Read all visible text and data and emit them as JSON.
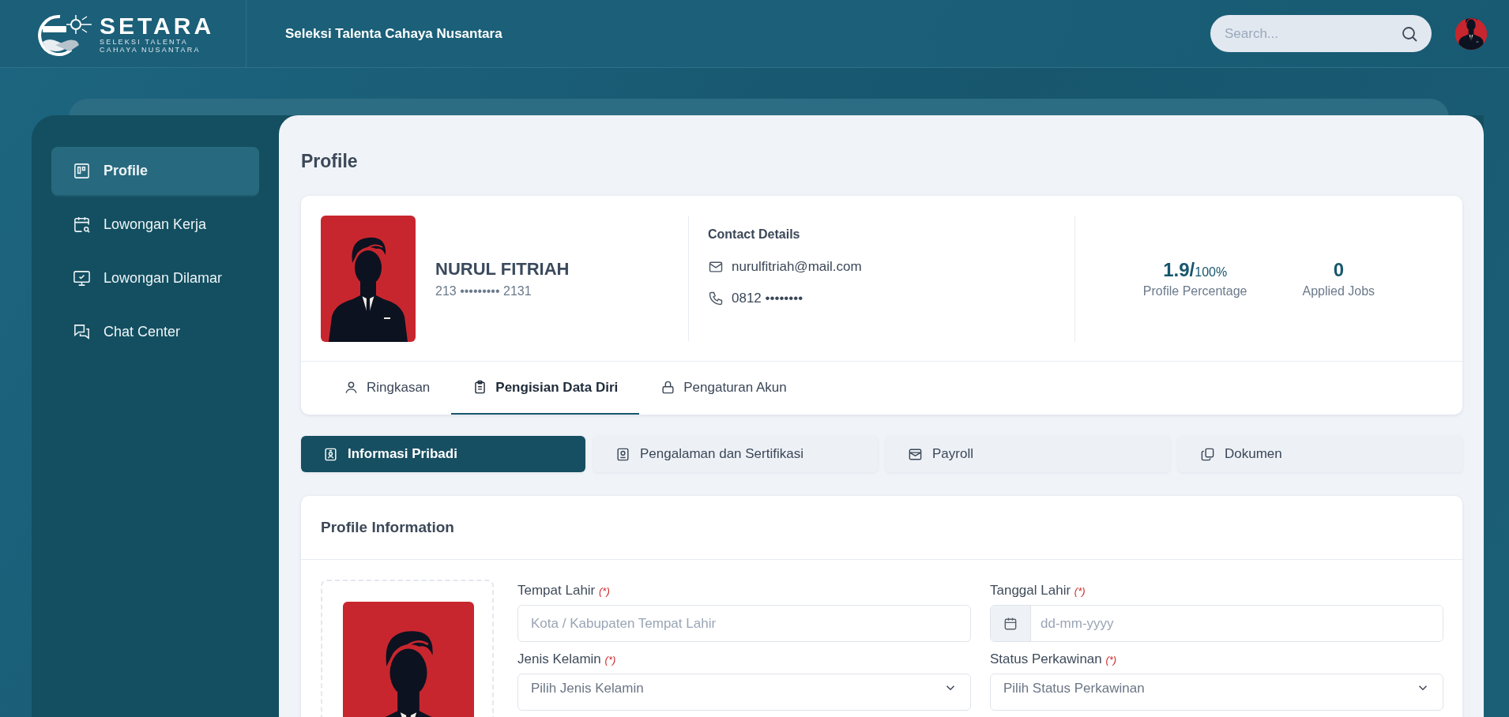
{
  "brand": {
    "name": "SETARA",
    "tagline_1": "SELEKSI TALENTA",
    "tagline_2": "CAHAYA NUSANTARA"
  },
  "header": {
    "title": "Seleksi Talenta Cahaya Nusantara",
    "search": {
      "placeholder": "Search..."
    }
  },
  "sidebar": {
    "items": [
      {
        "label": "Profile",
        "selected": true
      },
      {
        "label": "Lowongan Kerja",
        "selected": false
      },
      {
        "label": "Lowongan Dilamar",
        "selected": false
      },
      {
        "label": "Chat Center",
        "selected": false
      }
    ]
  },
  "page_title": "Profile",
  "profile": {
    "name": "NURUL FITRIAH",
    "id_number": "213 ••••••••• 2131",
    "contact_heading": "Contact Details",
    "email": "nurulfitriah@mail.com",
    "phone": "0812 ••••••••",
    "percentage": "1.9/",
    "percentage_total": "100%",
    "percentage_label": "Profile Percentage",
    "applied_jobs": "0",
    "applied_jobs_label": "Applied Jobs"
  },
  "tabs": [
    {
      "label": "Ringkasan",
      "selected": false
    },
    {
      "label": "Pengisian Data Diri",
      "selected": true
    },
    {
      "label": "Pengaturan Akun",
      "selected": false
    }
  ],
  "sections": [
    {
      "label": "Informasi Pribadi",
      "selected": true
    },
    {
      "label": "Pengalaman dan Sertifikasi",
      "selected": false
    },
    {
      "label": "Payroll",
      "selected": false
    },
    {
      "label": "Dokumen",
      "selected": false
    }
  ],
  "form": {
    "title": "Profile Information",
    "fields": [
      {
        "label": "Tempat Lahir",
        "required_mark": "(*)",
        "kind": "text",
        "placeholder": "Kota / Kabupaten Tempat Lahir"
      },
      {
        "label": "Tanggal Lahir",
        "required_mark": "(*)",
        "kind": "date",
        "placeholder": "dd-mm-yyyy"
      },
      {
        "label": "Jenis Kelamin",
        "required_mark": "(*)",
        "kind": "select",
        "placeholder": "Pilih Jenis Kelamin"
      },
      {
        "label": "Status Perkawinan",
        "required_mark": "(*)",
        "kind": "select",
        "placeholder": "Pilih Status Perkawinan"
      }
    ]
  }
}
